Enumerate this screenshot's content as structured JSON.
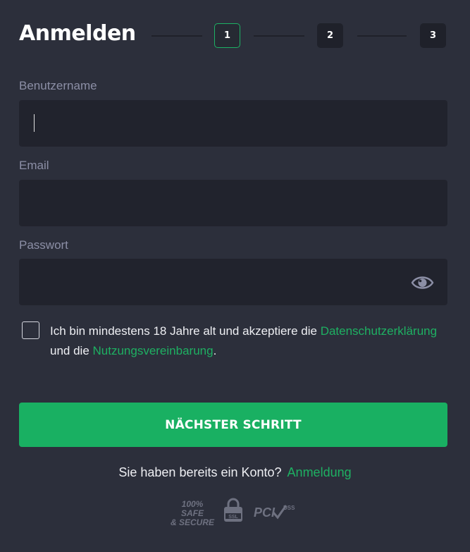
{
  "header": {
    "title": "Anmelden",
    "steps": [
      "1",
      "2",
      "3"
    ],
    "active_step": "1"
  },
  "form": {
    "username_label": "Benutzername",
    "username_value": "",
    "email_label": "Email",
    "email_value": "",
    "password_label": "Passwort",
    "password_value": "",
    "password_toggle_icon": "eye-icon"
  },
  "terms": {
    "checked": false,
    "text_before": "Ich bin mindestens 18 Jahre alt und akzeptiere die ",
    "privacy_link": "Datenschutzerklärung",
    "text_between": " und die ",
    "usage_link": "Nutzungsvereinbarung",
    "text_after": "."
  },
  "actions": {
    "next_button": "NÄCHSTER SCHRITT"
  },
  "footer": {
    "have_account": "Sie haben bereits ein Konto?",
    "login_link": "Anmeldung",
    "badge_safe_line1": "100% SAFE",
    "badge_safe_line2": "& SECURE",
    "badge_ssl": "SSL",
    "badge_pci": "PCI",
    "badge_dss": "DSS"
  },
  "colors": {
    "background": "#2c2f3b",
    "field": "#21232d",
    "accent": "#19b062"
  }
}
